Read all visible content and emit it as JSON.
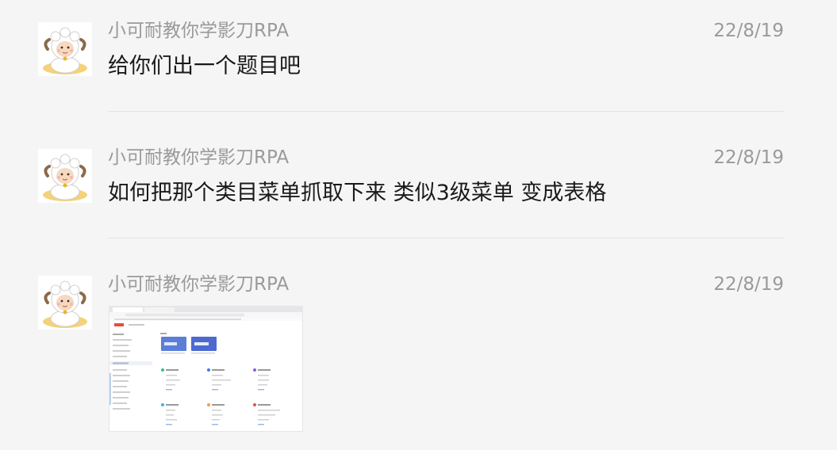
{
  "messages": [
    {
      "sender": "小可耐教你学影刀RPA",
      "time": "22/8/19",
      "text": "给你们出一个题目吧"
    },
    {
      "sender": "小可耐教你学影刀RPA",
      "time": "22/8/19",
      "text": "如何把那个类目菜单抓取下来 类似3级菜单 变成表格"
    },
    {
      "sender": "小可耐教你学影刀RPA",
      "time": "22/8/19",
      "image": "screenshot-thumbnail"
    }
  ],
  "icons": {
    "avatar": "goat-avatar-icon"
  },
  "colors": {
    "background": "#f5f5f5",
    "meta_text": "#9a9a9a",
    "body_text": "#1a1a1a",
    "divider": "#e2e2e2"
  }
}
